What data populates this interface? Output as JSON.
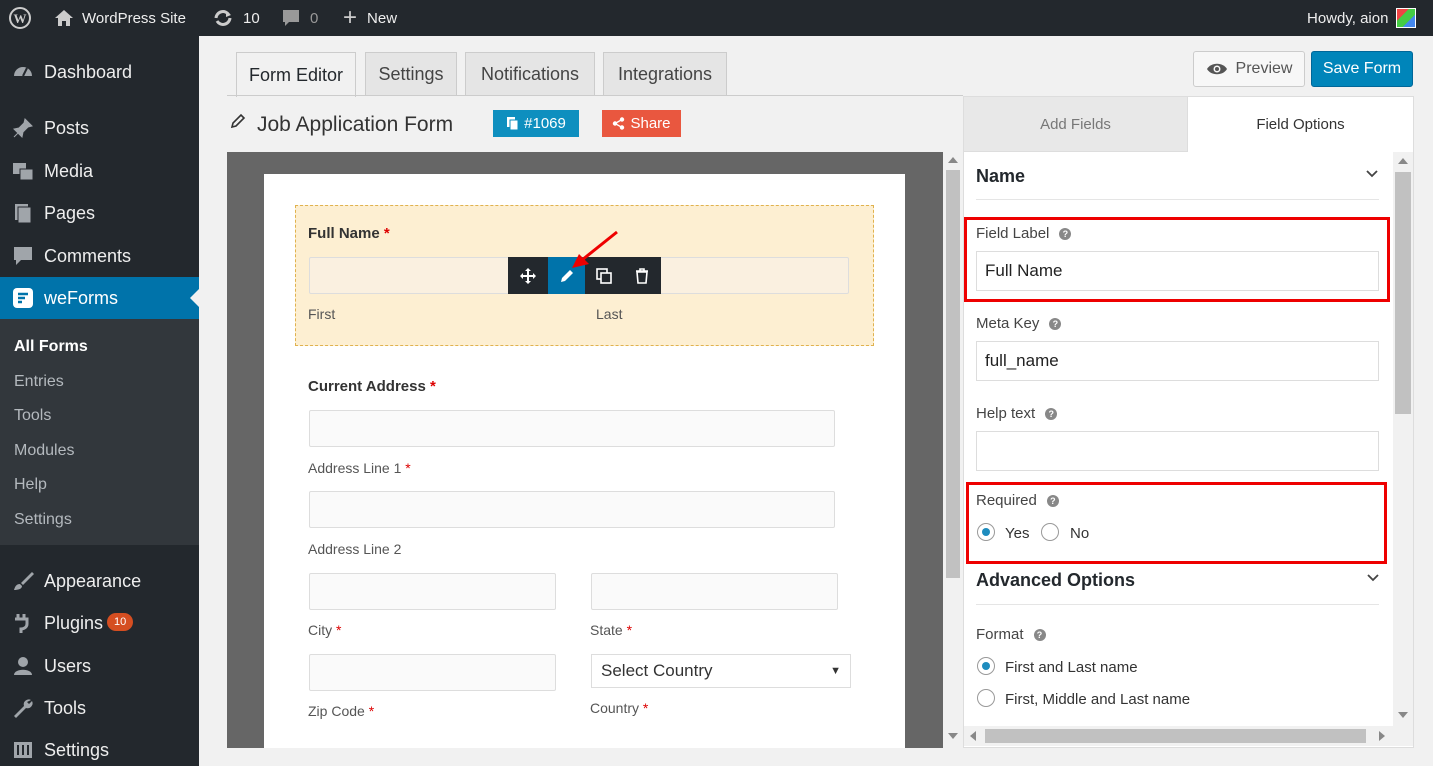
{
  "admin_bar": {
    "site_name": "WordPress Site",
    "updates": "10",
    "comments": "0",
    "new_label": "New",
    "howdy": "Howdy, aion"
  },
  "sidebar": {
    "items": [
      {
        "label": "Dashboard",
        "icon": "dashboard-icon"
      },
      {
        "label": "Posts",
        "icon": "pin-icon"
      },
      {
        "label": "Media",
        "icon": "media-icon"
      },
      {
        "label": "Pages",
        "icon": "pages-icon"
      },
      {
        "label": "Comments",
        "icon": "comment-icon"
      },
      {
        "label": "weForms",
        "icon": "weforms-icon"
      },
      {
        "label": "Appearance",
        "icon": "brush-icon"
      },
      {
        "label": "Plugins",
        "icon": "plugin-icon",
        "badge": "10"
      },
      {
        "label": "Users",
        "icon": "user-icon"
      },
      {
        "label": "Tools",
        "icon": "wrench-icon"
      },
      {
        "label": "Settings",
        "icon": "settings-icon"
      }
    ],
    "submenu": [
      "All Forms",
      "Entries",
      "Tools",
      "Modules",
      "Help",
      "Settings"
    ]
  },
  "tabs": [
    "Form Editor",
    "Settings",
    "Notifications",
    "Integrations"
  ],
  "preview_label": "Preview",
  "save_label": "Save Form",
  "form": {
    "title": "Job Application Form",
    "id_badge": "#1069",
    "share_label": "Share",
    "full_name_label": "Full Name",
    "first": "First",
    "last": "Last",
    "address_label": "Current Address",
    "line1": "Address Line 1",
    "line2": "Address Line 2",
    "city": "City",
    "state": "State",
    "zip": "Zip Code",
    "country_select": "Select Country",
    "country": "Country",
    "required_mark": "*"
  },
  "right_panel": {
    "tab_add": "Add Fields",
    "tab_options": "Field Options",
    "section_name": "Name",
    "field_label": "Field Label",
    "field_label_value": "Full Name",
    "meta_key": "Meta Key",
    "meta_key_value": "full_name",
    "help_text": "Help text",
    "required": "Required",
    "yes": "Yes",
    "no": "No",
    "advanced": "Advanced Options",
    "format": "Format",
    "format_opt1": "First and Last name",
    "format_opt2": "First, Middle and Last name"
  },
  "colors": {
    "accent": "#0073aa",
    "save": "#0085ba",
    "share": "#e9573f",
    "red_highlight": "#ee0000"
  }
}
